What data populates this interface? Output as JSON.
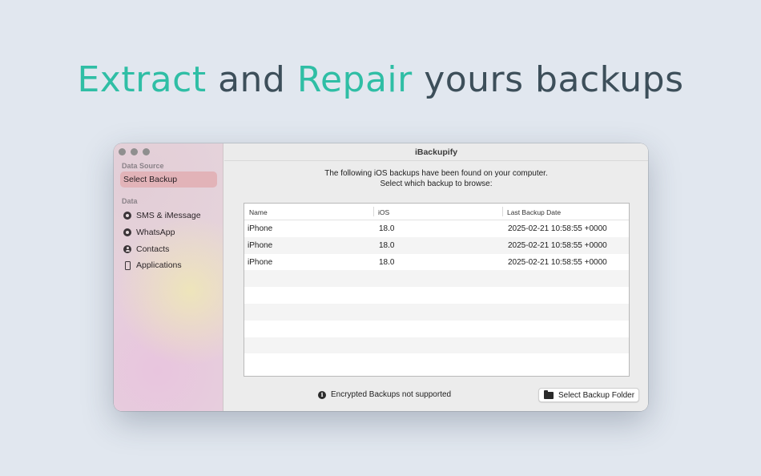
{
  "headline": {
    "part1": "Extract",
    "part2": " and ",
    "part3": "Repair",
    "part4": " yours backups"
  },
  "window": {
    "title": "iBackupify"
  },
  "sidebar": {
    "data_source_label": "Data Source",
    "select_backup": "Select Backup",
    "data_label": "Data",
    "items": [
      {
        "label": "SMS & iMessage",
        "icon": "message-circle-icon"
      },
      {
        "label": "WhatsApp",
        "icon": "whatsapp-icon"
      },
      {
        "label": "Contacts",
        "icon": "person-circle-icon"
      },
      {
        "label": "Applications",
        "icon": "phone-icon"
      }
    ]
  },
  "main": {
    "intro_line1": "The following iOS backups have been found on your computer.",
    "intro_line2": "Select which backup to browse:",
    "table": {
      "columns": [
        "Name",
        "iOS",
        "Last Backup Date"
      ],
      "rows": [
        [
          "iPhone",
          "18.0",
          "2025-02-21 10:58:55 +0000"
        ],
        [
          "iPhone",
          "18.0",
          "2025-02-21 10:58:55 +0000"
        ],
        [
          "iPhone",
          "18.0",
          "2025-02-21 10:58:55 +0000"
        ]
      ]
    },
    "encrypted_note": "Encrypted Backups not supported",
    "select_folder_button": "Select Backup Folder"
  },
  "colors": {
    "accent": "#2fbea5",
    "headline_dark": "#3d4f5a",
    "sidebar_selection": "#e2b3b8"
  }
}
